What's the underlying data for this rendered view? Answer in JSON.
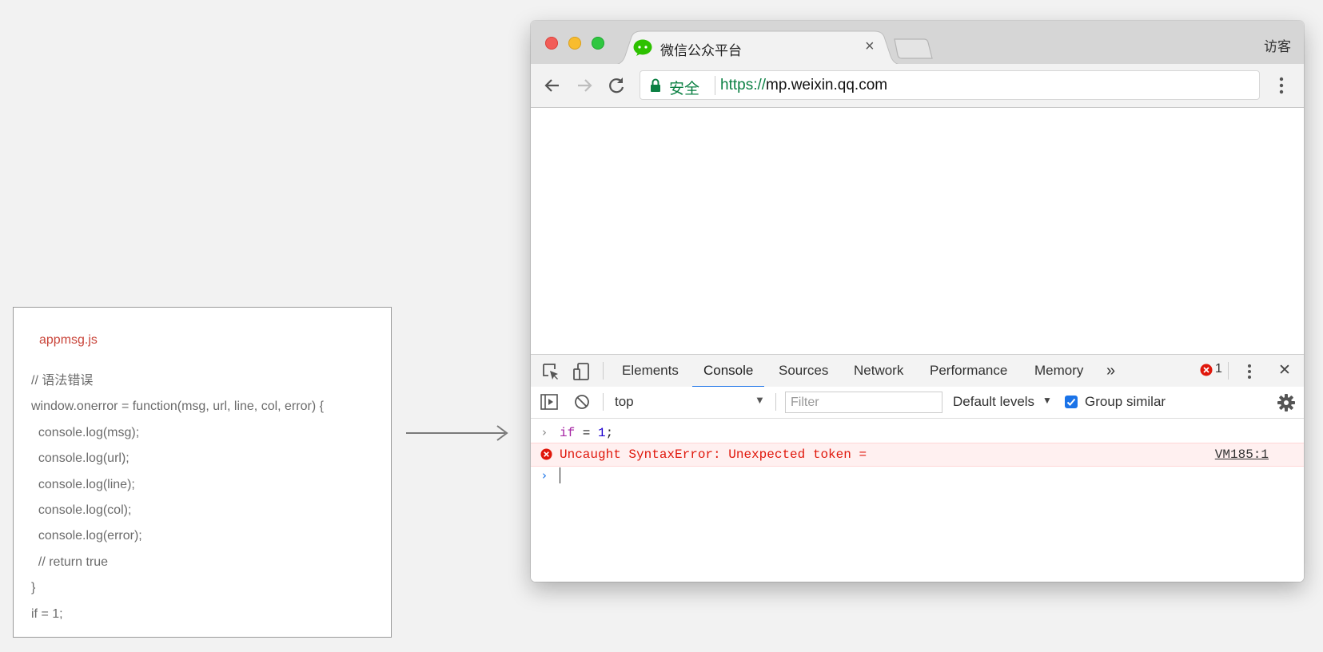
{
  "code_card": {
    "filename": "appmsg.js",
    "lines": [
      "// 语法错误",
      "window.onerror = function(msg, url, line, col, error) {",
      "  console.log(msg);",
      "  console.log(url);",
      "  console.log(line);",
      "  console.log(col);",
      "  console.log(error);",
      "  // return true",
      "}",
      "if = 1;"
    ]
  },
  "browser": {
    "tab_title": "微信公众平台",
    "tab_close": "×",
    "profile": "访客",
    "secure_label": "安全",
    "url_scheme": "https://",
    "url_host": "mp.weixin.qq.com"
  },
  "devtools": {
    "tabs": [
      "Elements",
      "Console",
      "Sources",
      "Network",
      "Performance",
      "Memory"
    ],
    "more": "»",
    "active_tab": "Console",
    "error_count": "1",
    "close": "✕",
    "context": "top",
    "filter_placeholder": "Filter",
    "levels": "Default levels",
    "group_similar": "Group similar",
    "group_similar_checked": true
  },
  "console": {
    "input_keyword": "if",
    "input_op": " = ",
    "input_number": "1",
    "input_end": ";",
    "error_message": "Uncaught SyntaxError: Unexpected token =",
    "error_source": "VM185:1"
  },
  "colors": {
    "accent": "#1a73e8",
    "error_text": "#e0170b",
    "secure_green": "#0b8043",
    "filename_red": "#c9453a"
  }
}
